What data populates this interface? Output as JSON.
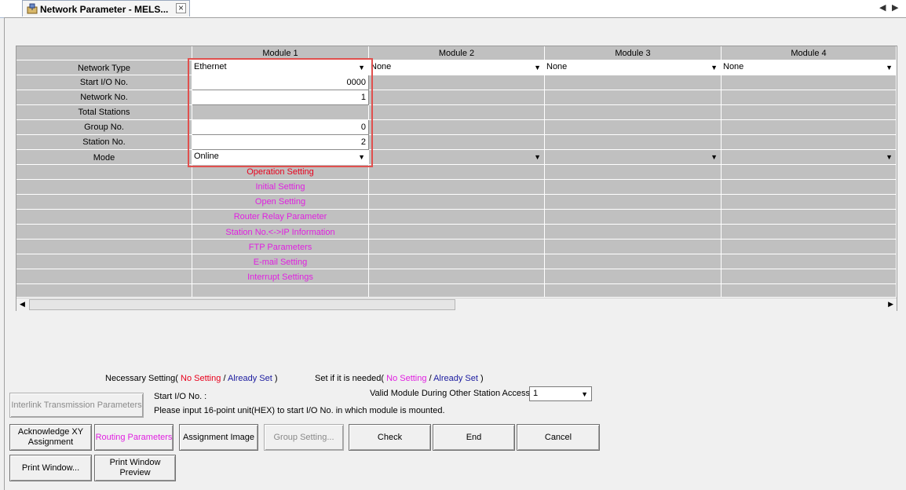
{
  "tab": {
    "title": "Network Parameter - MELS...",
    "close": "×",
    "nav_left": "◀",
    "nav_right": "▶"
  },
  "grid": {
    "headers": [
      "Module 1",
      "Module 2",
      "Module 3",
      "Module 4"
    ],
    "row_labels": {
      "network_type": "Network Type",
      "start_io": "Start I/O No.",
      "network_no": "Network No.",
      "total_stations": "Total Stations",
      "group_no": "Group No.",
      "station_no": "Station No.",
      "mode": "Mode"
    },
    "module1": {
      "network_type": "Ethernet",
      "start_io": "0000",
      "network_no": "1",
      "group_no": "0",
      "station_no": "2",
      "mode": "Online"
    },
    "module2": {
      "network_type": "None"
    },
    "module3": {
      "network_type": "None"
    },
    "module4": {
      "network_type": "None"
    },
    "links": {
      "operation_setting": "Operation Setting",
      "initial_setting": "Initial Setting",
      "open_setting": "Open Setting",
      "router_relay": "Router Relay Parameter",
      "station_ip": "Station No.<->IP Information",
      "ftp": "FTP Parameters",
      "email": "E-mail Setting",
      "interrupt": "Interrupt Settings"
    }
  },
  "legend": {
    "necessary_prefix": "Necessary Setting(",
    "necessary_no": "No Setting",
    "sep": "/",
    "necessary_set": "Already Set",
    "close": ")",
    "optional_prefix": "Set if it is needed(",
    "optional_no": "No Setting",
    "optional_set": "Already Set"
  },
  "info": {
    "start_io_label": "Start I/O No. :",
    "hint": "Please input 16-point unit(HEX) to start I/O No. in which module is mounted.",
    "valid_module_label": "Valid Module During Other Station Access",
    "valid_module_value": "1"
  },
  "buttons": {
    "interlink": "Interlink Transmission Parameters",
    "ack_xy_line1": "Acknowledge XY",
    "ack_xy_line2": "Assignment",
    "routing": "Routing Parameters",
    "assignment_image": "Assignment Image",
    "group_setting": "Group Setting...",
    "check": "Check",
    "end": "End",
    "cancel": "Cancel",
    "print_window": "Print Window...",
    "print_preview_line1": "Print Window",
    "print_preview_line2": "Preview"
  },
  "colors": {
    "no_setting_required": "#e8001c",
    "already_set": "#1b1b9f",
    "optional_no_setting": "#e020e0",
    "highlight": "#e0504e"
  }
}
